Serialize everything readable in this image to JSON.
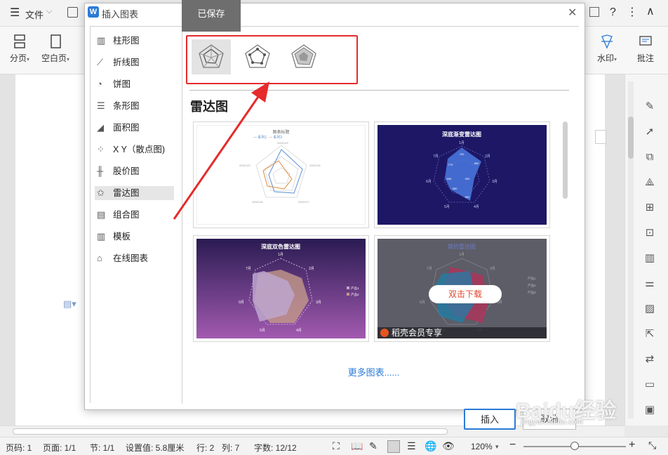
{
  "toolbar": {
    "menu_label": "文件",
    "saved_tooltip": "已保存",
    "help": "?"
  },
  "ribbon": {
    "page_break": "分页",
    "blank_page": "空白页",
    "watermark": "水印",
    "comment": "批注"
  },
  "dialog": {
    "title": "插入图表",
    "categories": [
      {
        "label": "柱形图",
        "icon": "column-chart-icon"
      },
      {
        "label": "折线图",
        "icon": "line-chart-icon"
      },
      {
        "label": "饼图",
        "icon": "pie-chart-icon"
      },
      {
        "label": "条形图",
        "icon": "bar-chart-icon"
      },
      {
        "label": "面积图",
        "icon": "area-chart-icon"
      },
      {
        "label": "X Y（散点图)",
        "icon": "scatter-chart-icon"
      },
      {
        "label": "股价图",
        "icon": "stock-chart-icon"
      },
      {
        "label": "雷达图",
        "icon": "radar-chart-icon"
      },
      {
        "label": "组合图",
        "icon": "combo-chart-icon"
      },
      {
        "label": "模板",
        "icon": "template-icon"
      },
      {
        "label": "在线图表",
        "icon": "online-chart-icon"
      }
    ],
    "selected_category": "雷达图",
    "section_title": "雷达图",
    "templates": [
      {
        "title": "图表标题",
        "legend": [
          "系列1",
          "系列2"
        ],
        "labels": [
          "2002/1/5",
          "2002/1/6",
          "2002/1/7",
          "2002/1/8",
          "2002/1/9"
        ],
        "theme": "light"
      },
      {
        "title": "深底渐变雷达图",
        "labels": [
          "1月",
          "2月",
          "3月",
          "4月",
          "5月",
          "6月",
          "7月"
        ],
        "values": [
          "700",
          "850",
          "900",
          "800",
          "580",
          "650",
          "770"
        ],
        "theme": "dark-blue"
      },
      {
        "title": "深底双色雷达图",
        "labels": [
          "1月",
          "2月",
          "3月",
          "4月",
          "5月",
          "0月",
          "7月"
        ],
        "legend": [
          "产品1",
          "产品2"
        ],
        "theme": "purple"
      },
      {
        "title": "简约雷达图",
        "labels": [
          "1月",
          "2月",
          "3月",
          "4月",
          "5月",
          "6月",
          "7月"
        ],
        "legend": [
          "产品1",
          "产品2",
          "产品3"
        ],
        "theme": "premium",
        "download_label": "双击下载",
        "badge": "稻壳会员专享"
      }
    ],
    "more_link": "更多图表......",
    "insert_button": "插入",
    "cancel_button": "取消",
    "colors": {
      "accent": "#2b7bd6",
      "highlight": "#e52b2b"
    }
  },
  "status": {
    "page_no": "页码: 1",
    "pages": "页面: 1/1",
    "section": "节: 1/1",
    "setting": "设置值: 5.8厘米",
    "row": "行: 2",
    "col": "列: 7",
    "words": "字数: 12/12",
    "zoom": "120%"
  },
  "watermark_text": "Baidu经验",
  "watermark_url": "jingyan.baidu.com"
}
